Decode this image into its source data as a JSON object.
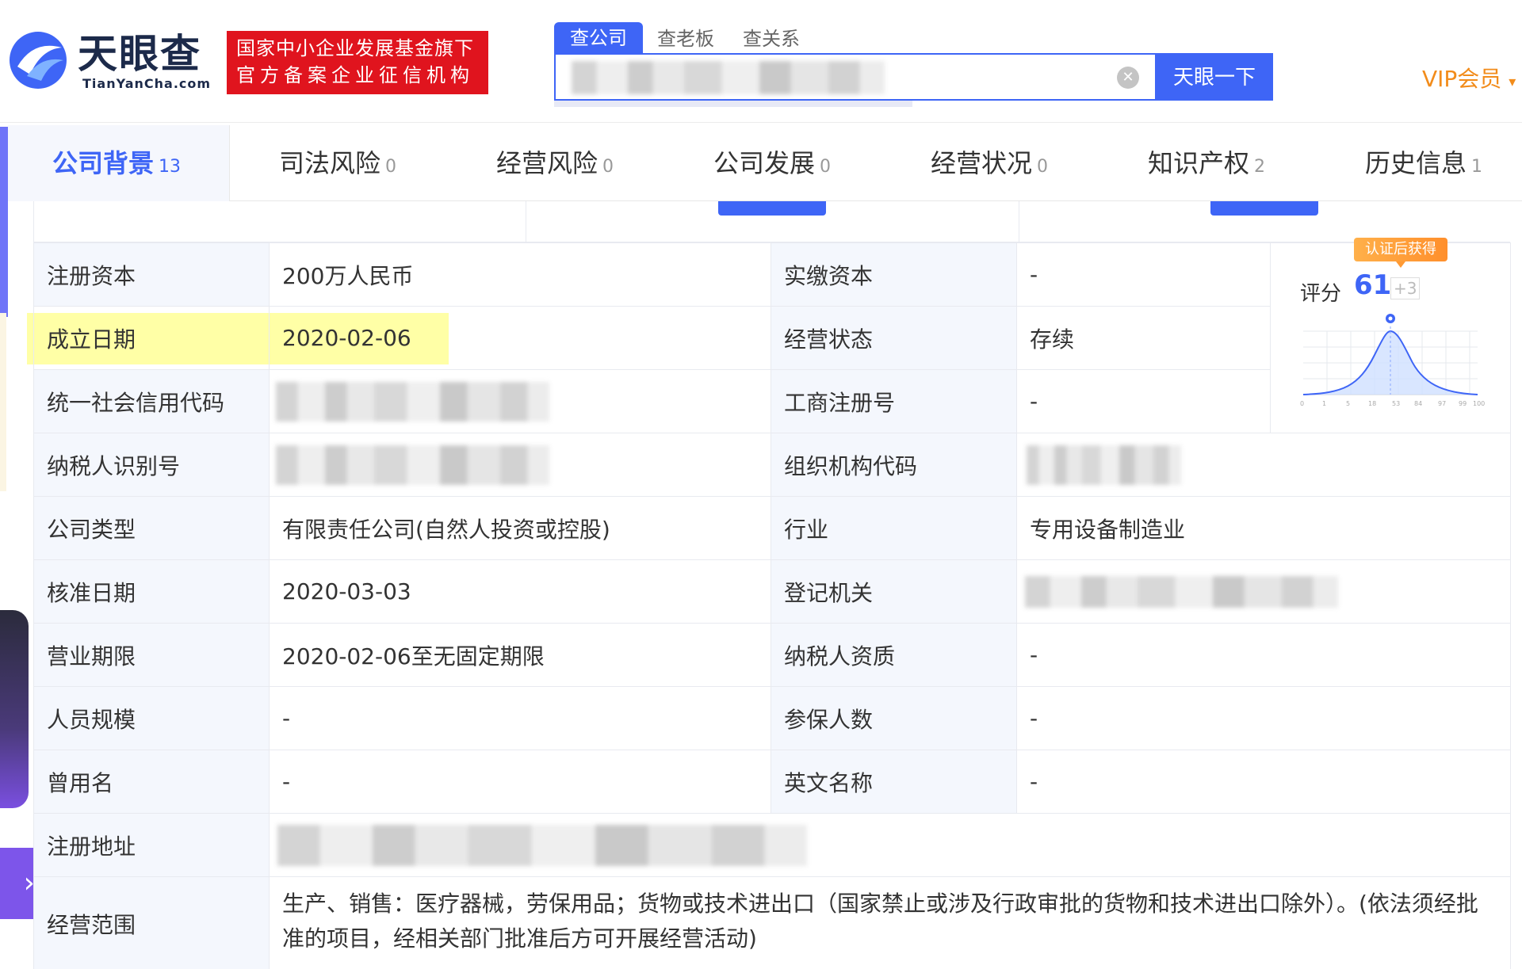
{
  "header": {
    "logo_main": "天眼查",
    "logo_sub": "TianYanCha.com",
    "badge_line1": "国家中小企业发展基金旗下",
    "badge_line2": "官方备案企业征信机构",
    "search_tabs": [
      {
        "label": "查公司",
        "active": true
      },
      {
        "label": "查老板",
        "active": false
      },
      {
        "label": "查关系",
        "active": false
      }
    ],
    "search_button": "天眼一下",
    "vip_label": "VIP会员",
    "accent_color": "#3e65f6",
    "badge_color": "#e0141e",
    "vip_color": "#f28c1b"
  },
  "nav": {
    "items": [
      {
        "label": "公司背景",
        "count": "13",
        "active": true
      },
      {
        "label": "司法风险",
        "count": "0",
        "active": false
      },
      {
        "label": "经营风险",
        "count": "0",
        "active": false
      },
      {
        "label": "公司发展",
        "count": "0",
        "active": false
      },
      {
        "label": "经营状况",
        "count": "0",
        "active": false
      },
      {
        "label": "知识产权",
        "count": "2",
        "active": false
      },
      {
        "label": "历史信息",
        "count": "1",
        "active": false
      }
    ]
  },
  "info": {
    "registered_capital_label": "注册资本",
    "registered_capital": "200万人民币",
    "paid_capital_label": "实缴资本",
    "paid_capital": "-",
    "established_label": "成立日期",
    "established": "2020-02-06",
    "status_label": "经营状态",
    "status": "存续",
    "credit_code_label": "统一社会信用代码",
    "biz_reg_no_label": "工商注册号",
    "biz_reg_no": "-",
    "taxpayer_id_label": "纳税人识别号",
    "org_code_label": "组织机构代码",
    "company_type_label": "公司类型",
    "company_type": "有限责任公司(自然人投资或控股)",
    "industry_label": "行业",
    "industry": "专用设备制造业",
    "approval_date_label": "核准日期",
    "approval_date": "2020-03-03",
    "registration_authority_label": "登记机关",
    "business_term_label": "营业期限",
    "business_term": "2020-02-06至无固定期限",
    "taxpayer_qual_label": "纳税人资质",
    "taxpayer_qual": "-",
    "staff_size_label": "人员规模",
    "staff_size": "-",
    "insured_count_label": "参保人数",
    "insured_count": "-",
    "former_name_label": "曾用名",
    "former_name": "-",
    "english_name_label": "英文名称",
    "english_name": "-",
    "address_label": "注册地址",
    "scope_label": "经营范围",
    "scope": "生产、销售：医疗器械，劳保用品；货物或技术进出口（国家禁止或涉及行政审批的货物和技术进出口除外）。(依法须经批准的项目，经相关部门批准后方可开展经营活动)"
  },
  "score": {
    "badge": "认证后获得",
    "label": "评分",
    "value": "61",
    "delta": "+3"
  }
}
